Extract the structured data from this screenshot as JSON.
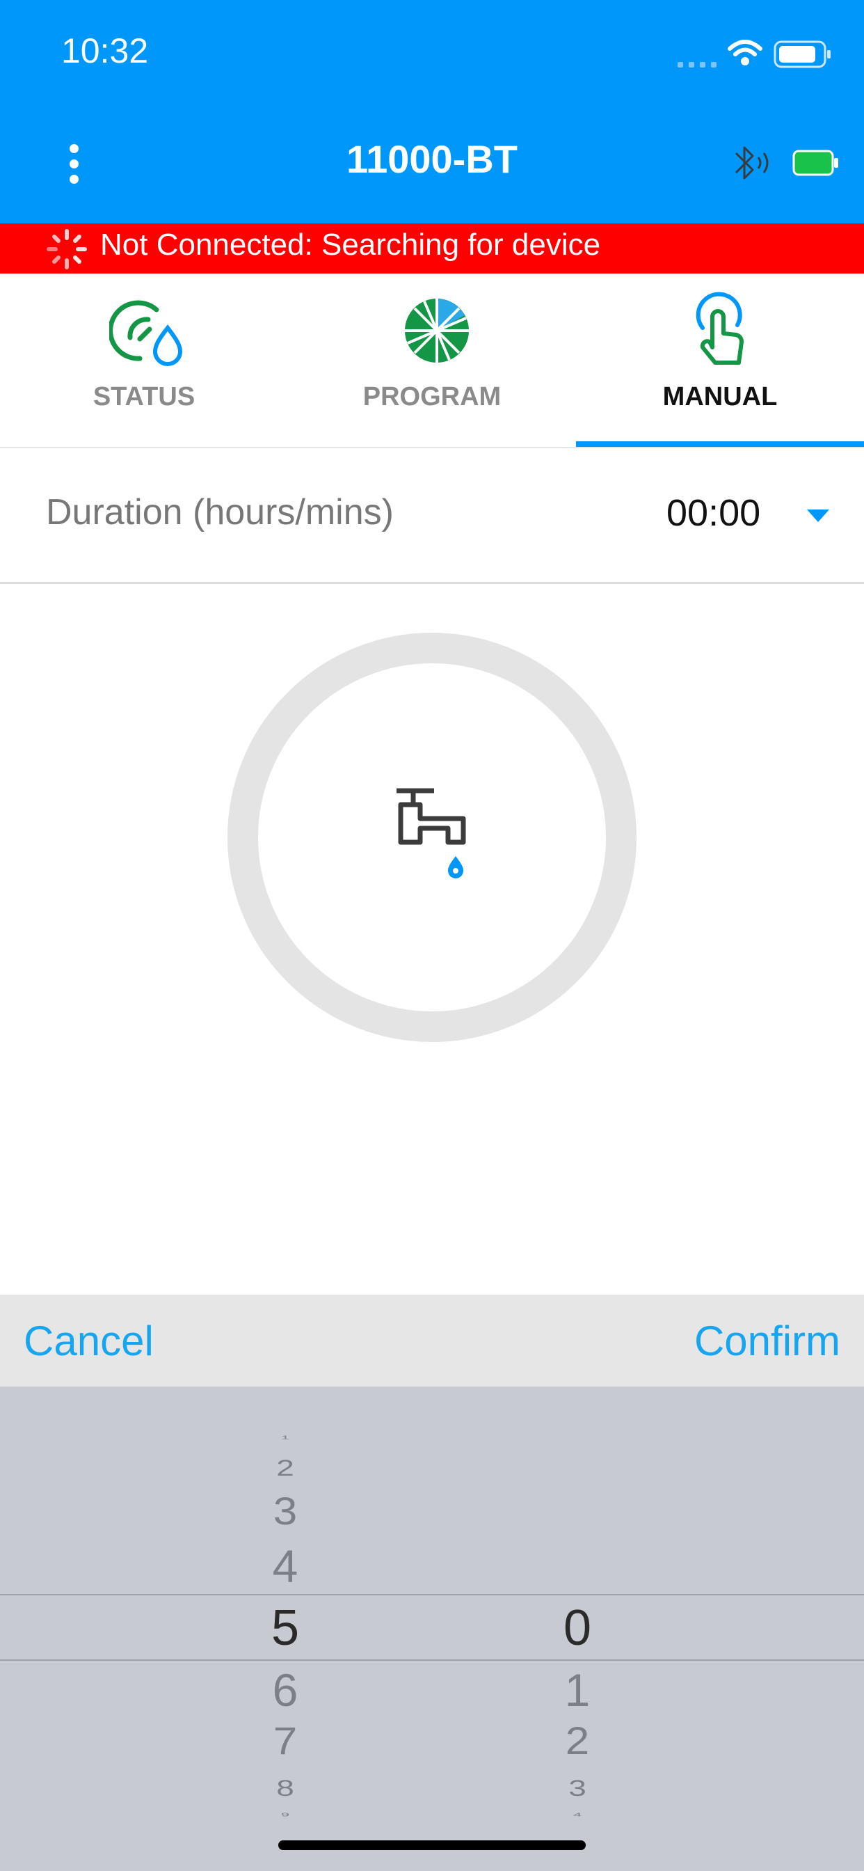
{
  "status_bar": {
    "time": "10:32"
  },
  "nav": {
    "title": "11000-BT"
  },
  "banner": {
    "text": "Not Connected: Searching for device"
  },
  "tabs": [
    {
      "label": "STATUS",
      "icon": "gauge-drop-icon"
    },
    {
      "label": "PROGRAM",
      "icon": "sprinkler-wheel-icon"
    },
    {
      "label": "MANUAL",
      "icon": "tap-hand-icon",
      "active": true
    }
  ],
  "duration": {
    "label": "Duration (hours/mins)",
    "value": "00:00"
  },
  "picker": {
    "cancel_label": "Cancel",
    "confirm_label": "Confirm",
    "hours": {
      "above": [
        "1",
        "2",
        "3",
        "4"
      ],
      "selected": "5",
      "below": [
        "6",
        "7",
        "8",
        "9"
      ]
    },
    "minutes": {
      "selected": "0",
      "below": [
        "1",
        "2",
        "3",
        "4"
      ]
    }
  },
  "colors": {
    "accent": "#0097FB",
    "banner": "#FF0000",
    "link": "#16A5EE",
    "icon_green": "#139645"
  }
}
